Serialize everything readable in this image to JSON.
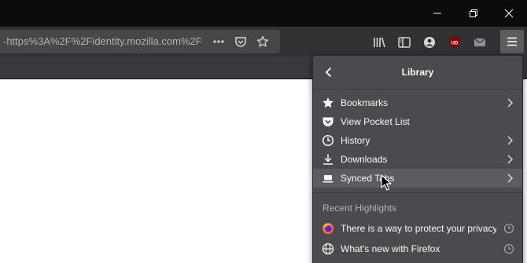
{
  "window": {
    "minimize_icon": "minimize-icon",
    "restore_icon": "restore-icon",
    "close_icon": "close-icon"
  },
  "urlbar": {
    "url": "-https%3A%2F%2Fidentity.mozilla.com%2F",
    "icons": [
      "more-actions-icon",
      "pocket-icon",
      "bookmark-star-icon"
    ]
  },
  "toolbar": {
    "icons": [
      "library-icon",
      "sidebars-icon",
      "account-icon",
      "ublock-icon",
      "mail-icon",
      "hamburger-menu-icon"
    ],
    "ublock_badge": "UD"
  },
  "panel": {
    "title": "Library",
    "items": [
      {
        "label": "Bookmarks",
        "icon": "star-icon",
        "chevron": true
      },
      {
        "label": "View Pocket List",
        "icon": "pocket-icon",
        "chevron": false
      },
      {
        "label": "History",
        "icon": "clock-icon",
        "chevron": true
      },
      {
        "label": "Downloads",
        "icon": "download-icon",
        "chevron": true
      },
      {
        "label": "Synced Tabs",
        "icon": "synced-tabs-icon",
        "chevron": true
      }
    ],
    "recent_highlights_title": "Recent Highlights",
    "highlights": [
      {
        "label": "There is a way to protect your privacy",
        "icon": "firefox-icon"
      },
      {
        "label": "What's new with Firefox",
        "icon": "globe-icon"
      }
    ]
  },
  "colors": {
    "titlebar": "#0c0c0d",
    "navbar": "#323234",
    "urlbar": "#474749",
    "panel": "#4a4a4f",
    "hover": "#5b5b60",
    "ublock_red": "#800000"
  }
}
